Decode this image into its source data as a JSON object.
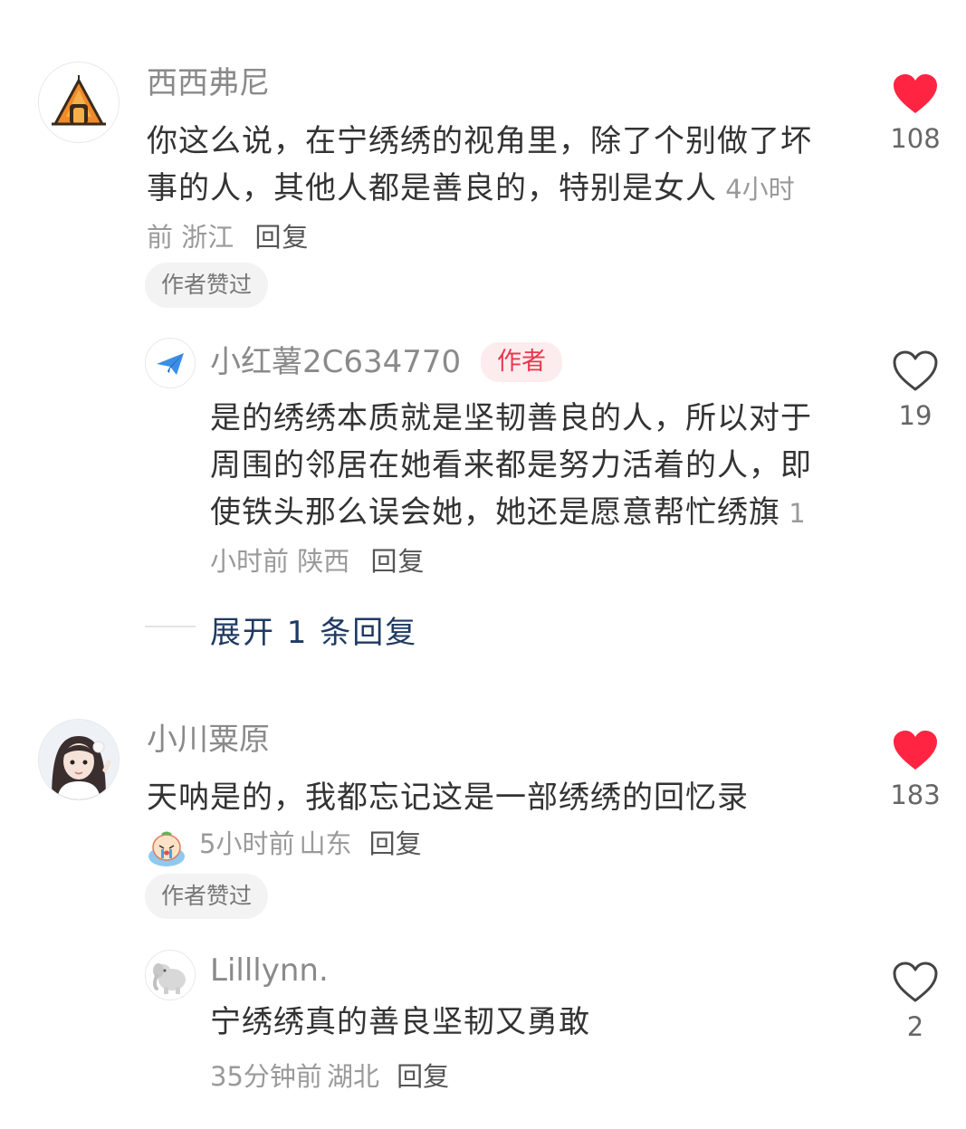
{
  "comments": [
    {
      "username": "西西弗尼",
      "text": "你这么说，在宁绣绣的视角里，除了个别做了坏事的人，其他人都是善良的，特别是女人",
      "time": "4小时前",
      "location": "浙江",
      "reply_label": "回复",
      "badge": "作者赞过",
      "likes": "108",
      "liked": true,
      "avatar_icon": "tent-icon",
      "reply": {
        "username": "小红薯2C634770",
        "author_tag": "作者",
        "text": "是的绣绣本质就是坚韧善良的人，所以对于周围的邻居在她看来都是努力活着的人，即使铁头那么误会她，她还是愿意帮忙绣旗",
        "time": "1小时前",
        "location": "陕西",
        "reply_label": "回复",
        "likes": "19",
        "liked": false,
        "avatar_icon": "paper-plane-icon"
      },
      "expand_label": "展开 1 条回复"
    },
    {
      "username": "小川粟原",
      "text": "天呐是的，我都忘记这是一部绣绣的回忆录",
      "emoji": "crying-face-emoji",
      "time": "5小时前",
      "location": "山东",
      "reply_label": "回复",
      "badge": "作者赞过",
      "likes": "183",
      "liked": true,
      "avatar_icon": "girl-portrait-avatar",
      "reply": {
        "username": "Lilllynn.",
        "text": "宁绣绣真的善良坚韧又勇敢",
        "time": "35分钟前",
        "location": "湖北",
        "reply_label": "回复",
        "likes": "2",
        "liked": false,
        "avatar_icon": "elephant-icon"
      }
    }
  ],
  "colors": {
    "like_active": "#ff2442",
    "author_tag_text": "#e8384f",
    "expand_link": "#1f3a63"
  }
}
